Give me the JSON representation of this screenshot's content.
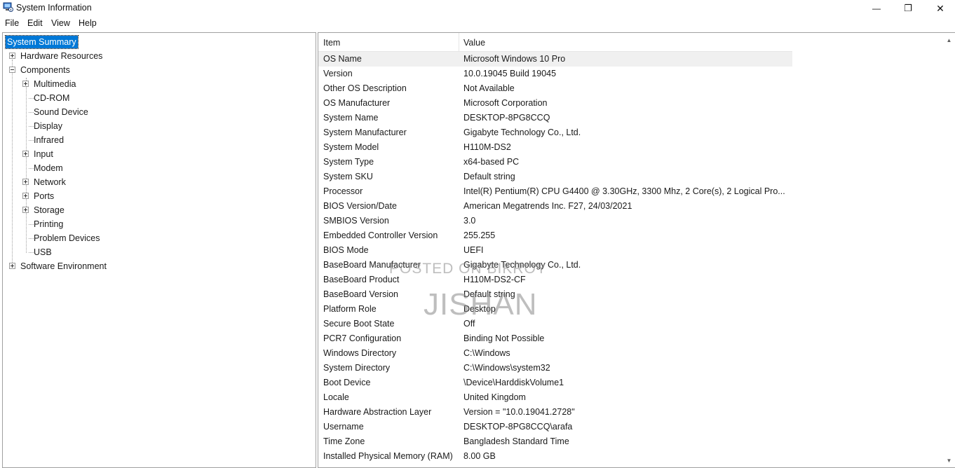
{
  "window": {
    "title": "System Information",
    "minimize_glyph": "—",
    "restore_glyph": "❐",
    "close_glyph": "✕"
  },
  "menu": [
    "File",
    "Edit",
    "View",
    "Help"
  ],
  "tree": {
    "system_summary": "System Summary",
    "hardware_resources": "Hardware Resources",
    "components": "Components",
    "children": [
      "Multimedia",
      "CD-ROM",
      "Sound Device",
      "Display",
      "Infrared",
      "Input",
      "Modem",
      "Network",
      "Ports",
      "Storage",
      "Printing",
      "Problem Devices",
      "USB"
    ],
    "software_environment": "Software Environment"
  },
  "table": {
    "headers": {
      "item": "Item",
      "value": "Value"
    },
    "rows": [
      {
        "item": "OS Name",
        "value": "Microsoft Windows 10 Pro"
      },
      {
        "item": "Version",
        "value": "10.0.19045 Build 19045"
      },
      {
        "item": "Other OS Description",
        "value": "Not Available"
      },
      {
        "item": "OS Manufacturer",
        "value": "Microsoft Corporation"
      },
      {
        "item": "System Name",
        "value": "DESKTOP-8PG8CCQ"
      },
      {
        "item": "System Manufacturer",
        "value": "Gigabyte Technology Co., Ltd."
      },
      {
        "item": "System Model",
        "value": "H110M-DS2"
      },
      {
        "item": "System Type",
        "value": "x64-based PC"
      },
      {
        "item": "System SKU",
        "value": "Default string"
      },
      {
        "item": "Processor",
        "value": "Intel(R) Pentium(R) CPU G4400 @ 3.30GHz, 3300 Mhz, 2 Core(s), 2 Logical Pro..."
      },
      {
        "item": "BIOS Version/Date",
        "value": "American Megatrends Inc. F27, 24/03/2021"
      },
      {
        "item": "SMBIOS Version",
        "value": "3.0"
      },
      {
        "item": "Embedded Controller Version",
        "value": "255.255"
      },
      {
        "item": "BIOS Mode",
        "value": "UEFI"
      },
      {
        "item": "BaseBoard Manufacturer",
        "value": "Gigabyte Technology Co., Ltd."
      },
      {
        "item": "BaseBoard Product",
        "value": "H110M-DS2-CF"
      },
      {
        "item": "BaseBoard Version",
        "value": "Default string"
      },
      {
        "item": "Platform Role",
        "value": "Desktop"
      },
      {
        "item": "Secure Boot State",
        "value": "Off"
      },
      {
        "item": "PCR7 Configuration",
        "value": "Binding Not Possible"
      },
      {
        "item": "Windows Directory",
        "value": "C:\\Windows"
      },
      {
        "item": "System Directory",
        "value": "C:\\Windows\\system32"
      },
      {
        "item": "Boot Device",
        "value": "\\Device\\HarddiskVolume1"
      },
      {
        "item": "Locale",
        "value": "United Kingdom"
      },
      {
        "item": "Hardware Abstraction Layer",
        "value": "Version = \"10.0.19041.2728\""
      },
      {
        "item": "Username",
        "value": "DESKTOP-8PG8CCQ\\arafa"
      },
      {
        "item": "Time Zone",
        "value": "Bangladesh Standard Time"
      },
      {
        "item": "Installed Physical Memory (RAM)",
        "value": "8.00 GB"
      }
    ]
  },
  "watermark": {
    "line1": "POSTED ON BIKROY",
    "line2": "JISHAN"
  },
  "colors": {
    "selection": "#0078d7",
    "row_highlight": "#f0f0f0",
    "border": "#a0a0a0"
  }
}
